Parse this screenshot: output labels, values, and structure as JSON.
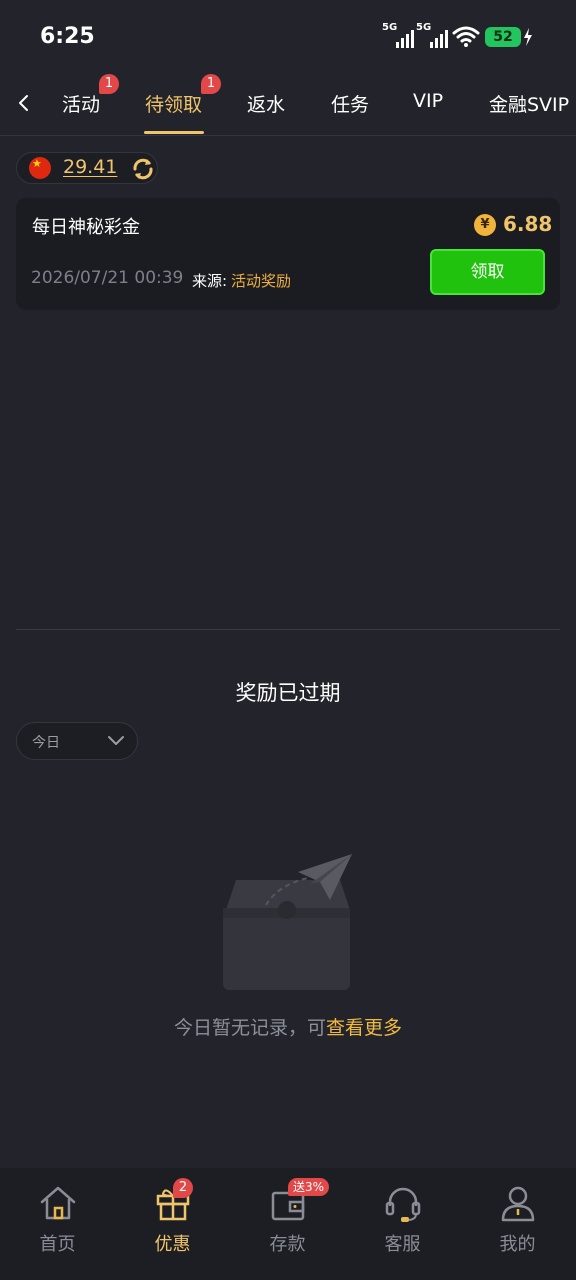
{
  "status": {
    "time": "6:25",
    "signal1": "5G",
    "signal2": "5G",
    "battery": "52"
  },
  "tabs": [
    {
      "label": "活动",
      "badge": "1"
    },
    {
      "label": "待领取",
      "badge": "1",
      "active": true
    },
    {
      "label": "返水"
    },
    {
      "label": "任务"
    },
    {
      "label": "VIP"
    },
    {
      "label": "金融SVIP"
    }
  ],
  "balance": {
    "amount": "29.41"
  },
  "reward_card": {
    "title": "每日神秘彩金",
    "currency_symbol": "¥",
    "amount": "6.88",
    "date": "2026/07/21 00:39",
    "source_label": "来源:",
    "source_value": "活动奖励",
    "claim_label": "领取"
  },
  "expired": {
    "title": "奖励已过期",
    "filter_value": "今日",
    "empty_text": "今日暂无记录，可",
    "empty_link": "查看更多"
  },
  "bottom_nav": [
    {
      "label": "首页",
      "icon": "home-icon"
    },
    {
      "label": "优惠",
      "icon": "gift-icon",
      "badge": "2",
      "active": true
    },
    {
      "label": "存款",
      "icon": "wallet-icon",
      "promo": "送3%"
    },
    {
      "label": "客服",
      "icon": "headset-icon"
    },
    {
      "label": "我的",
      "icon": "user-icon"
    }
  ],
  "colors": {
    "accent": "#f0c46a",
    "claim_green": "#20c20e",
    "badge_red": "#e24848",
    "background": "#23242b"
  }
}
